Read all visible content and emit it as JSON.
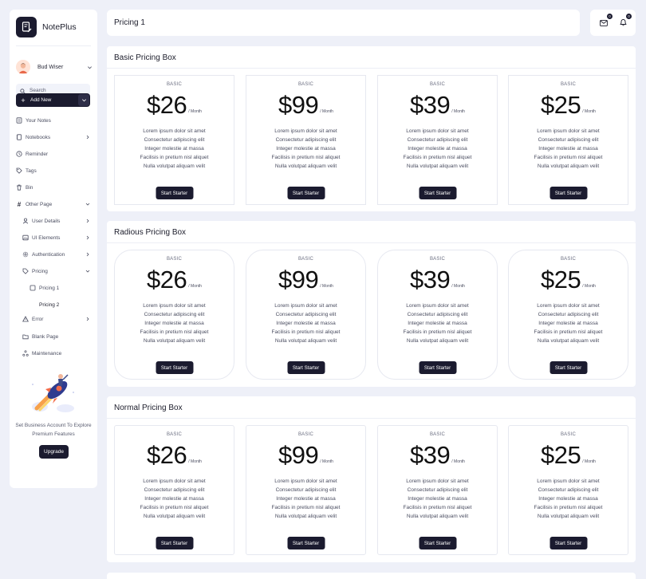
{
  "app": {
    "name": "NotePlus"
  },
  "user": {
    "name": "Bud Wiser"
  },
  "search": {
    "placeholder": "Search"
  },
  "add_new": {
    "label": "Add New"
  },
  "nav": {
    "your_notes": "Your Notes",
    "notebooks": "Notebooks",
    "reminder": "Reminder",
    "tags": "Tags",
    "bin": "Bin",
    "other_page": "Other Page",
    "user_details": "User Details",
    "ui_elements": "UI Elements",
    "authentication": "Authentication",
    "pricing": "Pricing",
    "pricing_1": "Pricing 1",
    "pricing_2": "Pricing 2",
    "error": "Error",
    "blank_page": "Blank Page",
    "maintenance": "Maintenance"
  },
  "promo": {
    "text": "Set Business Account To Explore Premium Features",
    "button": "Upgrade"
  },
  "header": {
    "title": "Pricing 1",
    "mail_badge": "0",
    "bell_badge": "0"
  },
  "sections": [
    {
      "title": "Basic Pricing Box",
      "cards": [
        {
          "plan": "BASIC",
          "price": "$26",
          "period": "/ Month",
          "features": [
            "Lorem ipsum dolor sit amet",
            "Consectetur adipiscing elit",
            "Integer molestie at massa",
            "Facilisis in pretium nisl aliquet",
            "Nulla volutpat aliquam velit"
          ],
          "button": "Start Starter"
        },
        {
          "plan": "BASIC",
          "price": "$99",
          "period": "/ Month",
          "features": [
            "Lorem ipsum dolor sit amet",
            "Consectetur adipiscing elit",
            "Integer molestie at massa",
            "Facilisis in pretium nisl aliquet",
            "Nulla volutpat aliquam velit"
          ],
          "button": "Start Starter"
        },
        {
          "plan": "BASIC",
          "price": "$39",
          "period": "/ Month",
          "features": [
            "Lorem ipsum dolor sit amet",
            "Consectetur adipiscing elit",
            "Integer molestie at massa",
            "Facilisis in pretium nisl aliquet",
            "Nulla volutpat aliquam velit"
          ],
          "button": "Start Starter"
        },
        {
          "plan": "BASIC",
          "price": "$25",
          "period": "/ Month",
          "features": [
            "Lorem ipsum dolor sit amet",
            "Consectetur adipiscing elit",
            "Integer molestie at massa",
            "Facilisis in pretium nisl aliquet",
            "Nulla volutpat aliquam velit"
          ],
          "button": "Start Starter"
        }
      ]
    },
    {
      "title": "Radious Pricing Box",
      "cards": [
        {
          "plan": "BASIC",
          "price": "$26",
          "period": "/ Month",
          "features": [
            "Lorem ipsum dolor sit amet",
            "Consectetur adipiscing elit",
            "Integer molestie at massa",
            "Facilisis in pretium nisl aliquet",
            "Nulla volutpat aliquam velit"
          ],
          "button": "Start Starter"
        },
        {
          "plan": "BASIC",
          "price": "$99",
          "period": "/ Month",
          "features": [
            "Lorem ipsum dolor sit amet",
            "Consectetur adipiscing elit",
            "Integer molestie at massa",
            "Facilisis in pretium nisl aliquet",
            "Nulla volutpat aliquam velit"
          ],
          "button": "Start Starter"
        },
        {
          "plan": "BASIC",
          "price": "$39",
          "period": "/ Month",
          "features": [
            "Lorem ipsum dolor sit amet",
            "Consectetur adipiscing elit",
            "Integer molestie at massa",
            "Facilisis in pretium nisl aliquet",
            "Nulla volutpat aliquam velit"
          ],
          "button": "Start Starter"
        },
        {
          "plan": "BASIC",
          "price": "$25",
          "period": "/ Month",
          "features": [
            "Lorem ipsum dolor sit amet",
            "Consectetur adipiscing elit",
            "Integer molestie at massa",
            "Facilisis in pretium nisl aliquet",
            "Nulla volutpat aliquam velit"
          ],
          "button": "Start Starter"
        }
      ]
    },
    {
      "title": "Normal Pricing Box",
      "cards": [
        {
          "plan": "BASIC",
          "price": "$26",
          "period": "/ Month",
          "features": [
            "Lorem ipsum dolor sit amet",
            "Consectetur adipiscing elit",
            "Integer molestie at massa",
            "Facilisis in pretium nisl aliquet",
            "Nulla volutpat aliquam velit"
          ],
          "button": "Start Starter"
        },
        {
          "plan": "BASIC",
          "price": "$99",
          "period": "/ Month",
          "features": [
            "Lorem ipsum dolor sit amet",
            "Consectetur adipiscing elit",
            "Integer molestie at massa",
            "Facilisis in pretium nisl aliquet",
            "Nulla volutpat aliquam velit"
          ],
          "button": "Start Starter"
        },
        {
          "plan": "BASIC",
          "price": "$39",
          "period": "/ Month",
          "features": [
            "Lorem ipsum dolor sit amet",
            "Consectetur adipiscing elit",
            "Integer molestie at massa",
            "Facilisis in pretium nisl aliquet",
            "Nulla volutpat aliquam velit"
          ],
          "button": "Start Starter"
        },
        {
          "plan": "BASIC",
          "price": "$25",
          "period": "/ Month",
          "features": [
            "Lorem ipsum dolor sit amet",
            "Consectetur adipiscing elit",
            "Integer molestie at massa",
            "Facilisis in pretium nisl aliquet",
            "Nulla volutpat aliquam velit"
          ],
          "button": "Start Starter"
        }
      ]
    }
  ],
  "colors": {
    "accent": "#1b1b2f",
    "background": "#eef0f8",
    "surface": "#ffffff"
  }
}
